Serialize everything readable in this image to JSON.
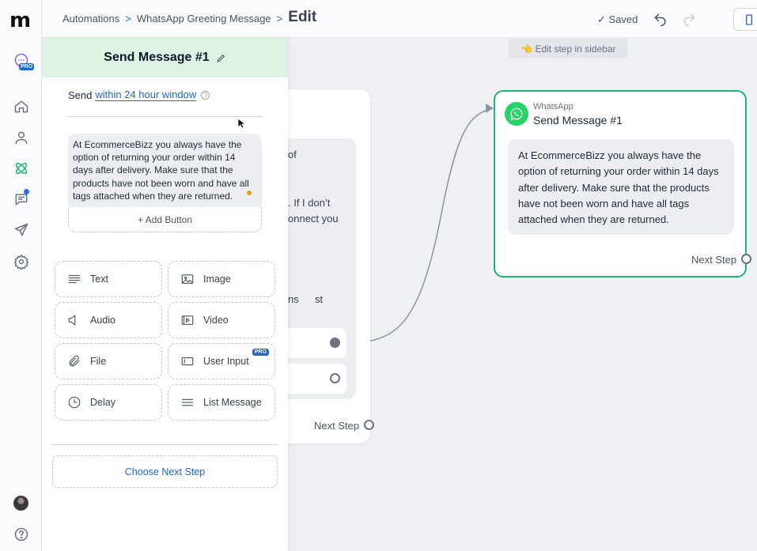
{
  "app": {
    "logo": "m",
    "pro_badge": "PRO"
  },
  "breadcrumb": {
    "items": [
      "Automations",
      "WhatsApp Greeting Message"
    ],
    "current": "Edit",
    "separator": ">"
  },
  "topbar": {
    "saved_label": "Saved"
  },
  "canvas": {
    "hint": "Edit step in sidebar",
    "hint_icon": "👈",
    "back_fragments": {
      "line1": "of",
      "line2": ". If I don’t",
      "line3": "onnect you",
      "line4": "ns",
      "line4b": "st"
    },
    "back_next_step": "Next Step",
    "whatsapp_card": {
      "label": "WhatsApp",
      "title": "Send Message #1",
      "message": "At EcommerceBizz you always have the option of returning your order within 14 days after delivery. Make sure that the products have not been worn and have all tags attached when they are returned.",
      "next_step": "Next Step"
    }
  },
  "sidebar": {
    "title": "Send Message #1",
    "send_prefix": "Send",
    "send_window": "within 24 hour window",
    "message": "At EcommerceBizz you always have the option of returning your order within 14 days after delivery. Make sure that the products have not been worn and have all tags attached when they are returned.",
    "add_button": "+ Add Button",
    "tiles": [
      {
        "label": "Text",
        "icon": "text-lines-icon"
      },
      {
        "label": "Image",
        "icon": "image-icon"
      },
      {
        "label": "Audio",
        "icon": "speaker-icon"
      },
      {
        "label": "Video",
        "icon": "video-icon"
      },
      {
        "label": "File",
        "icon": "paperclip-icon"
      },
      {
        "label": "User Input",
        "icon": "input-box-icon",
        "badge": "PRO"
      },
      {
        "label": "Delay",
        "icon": "clock-icon"
      },
      {
        "label": "List Message",
        "icon": "list-icon"
      }
    ],
    "choose_next_step": "Choose Next Step"
  },
  "colors": {
    "accent_green": "#22b573",
    "link_blue": "#1e66d0",
    "header_green": "#ddf3e4"
  }
}
